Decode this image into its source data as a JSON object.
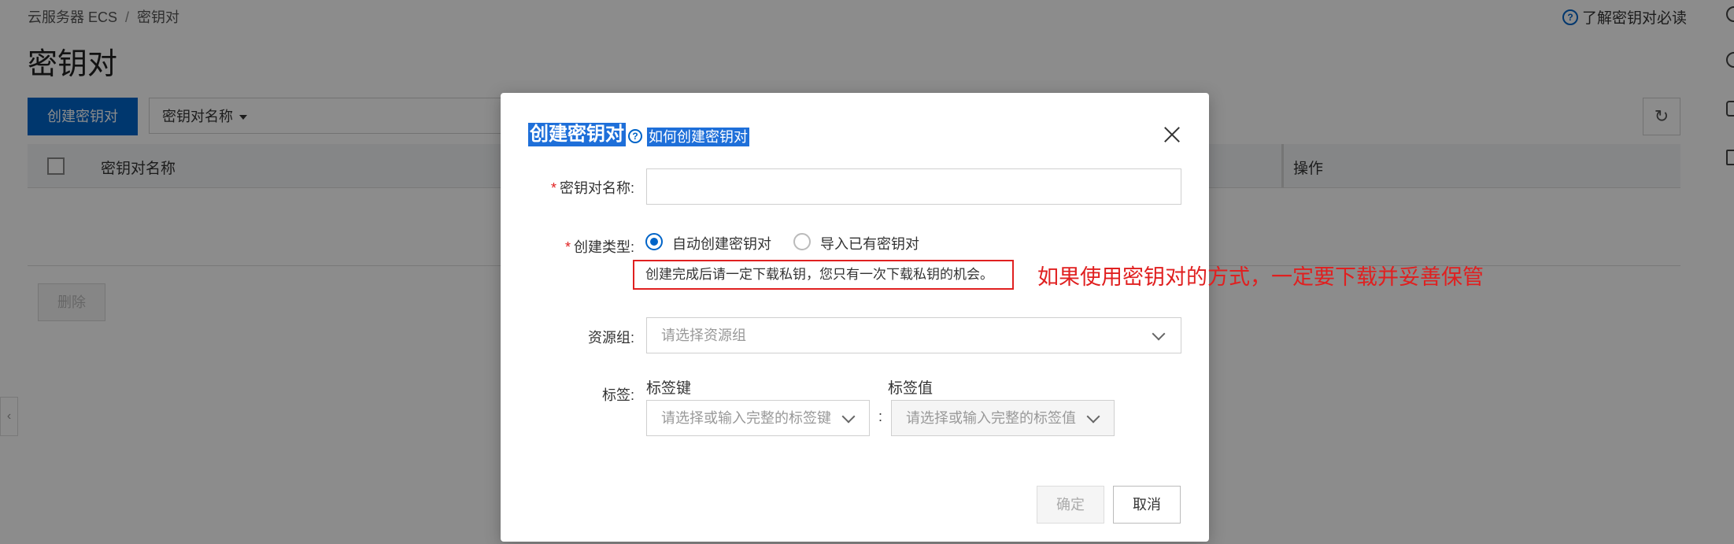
{
  "header": {
    "breadcrumb": [
      "云服务器 ECS",
      "/",
      "密钥对"
    ],
    "title": "密钥对",
    "help_link": "了解密钥对必读"
  },
  "toolbar": {
    "create_button": "创建密钥对",
    "filter_field": "密钥对名称"
  },
  "table": {
    "columns": [
      "密钥对名称",
      "操作"
    ],
    "delete_button": "删除"
  },
  "modal": {
    "title": "创建密钥对",
    "help_link": "如何创建密钥对",
    "fields": {
      "name_label": "密钥对名称:",
      "type_label": "创建类型:",
      "type_options": [
        "自动创建密钥对",
        "导入已有密钥对"
      ],
      "type_selected": "自动创建密钥对",
      "warning": "创建完成后请一定下载私钥，您只有一次下载私钥的机会。",
      "resource_group_label": "资源组:",
      "resource_group_placeholder": "请选择资源组",
      "tags_label": "标签:",
      "tag_key_header": "标签键",
      "tag_value_header": "标签值",
      "tag_key_placeholder": "请选择或输入完整的标签键",
      "tag_value_placeholder": "请选择或输入完整的标签值",
      "tag_colon": ":"
    },
    "buttons": {
      "ok": "确定",
      "cancel": "取消"
    }
  },
  "annotation": "如果使用密钥对的方式，一定要下载并妥善保管",
  "colors": {
    "primary": "#0064c8",
    "highlight_red": "#e02020",
    "selection": "#1e6fd9"
  }
}
